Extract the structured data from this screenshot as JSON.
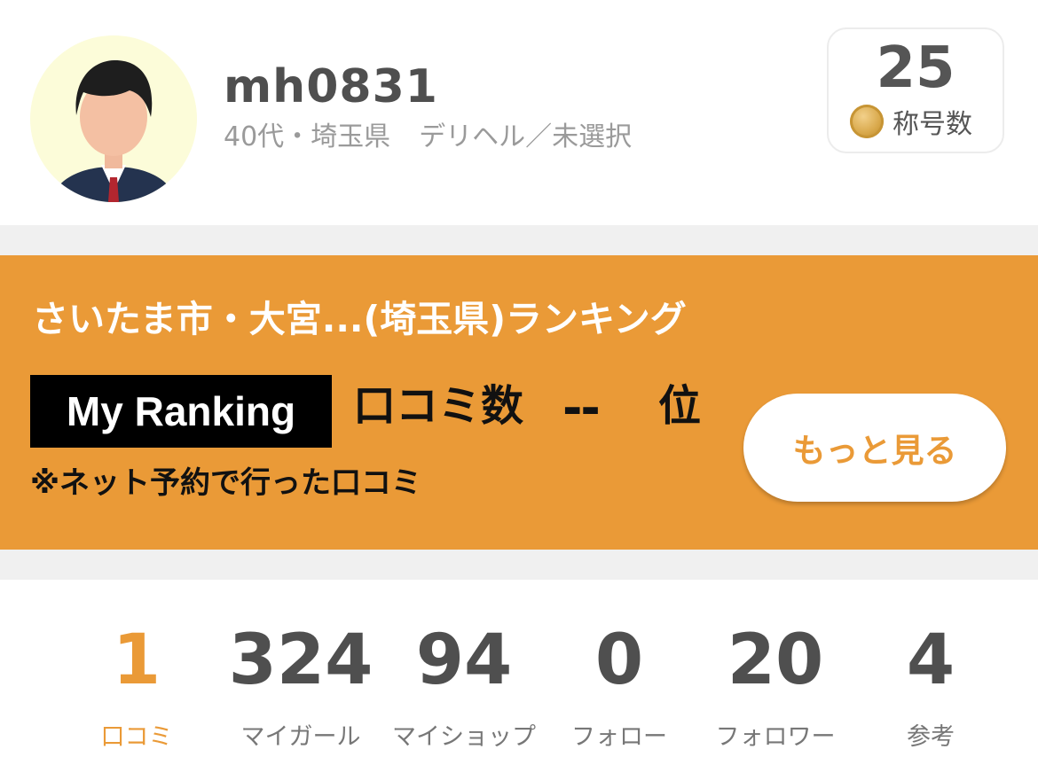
{
  "profile": {
    "avatar_icon": "user-avatar-icon",
    "username": "mh0831",
    "age_region": "40代・埼玉県",
    "category": "デリヘル／未選択",
    "title_count": "25",
    "title_label": "称号数",
    "medal_icon": "gold-medal-icon"
  },
  "ranking": {
    "heading": "さいたま市・大宮...(埼玉県)ランキング",
    "badge": "My Ranking",
    "metric": "口コミ数",
    "value": "--",
    "unit": "位",
    "note": "※ネット予約で行った口コミ",
    "more_button": "もっと見る"
  },
  "stats": [
    {
      "value": "1",
      "label": "口コミ",
      "active": true
    },
    {
      "value": "324",
      "label": "マイガール"
    },
    {
      "value": "94",
      "label": "マイショップ"
    },
    {
      "value": "0",
      "label": "フォロー"
    },
    {
      "value": "20",
      "label": "フォロワー"
    },
    {
      "value": "4",
      "label": "参考"
    }
  ],
  "colors": {
    "accent": "#ea9a37",
    "text": "#4f4f4f",
    "muted": "#9a9a9a",
    "separator": "#f0f0f0"
  }
}
